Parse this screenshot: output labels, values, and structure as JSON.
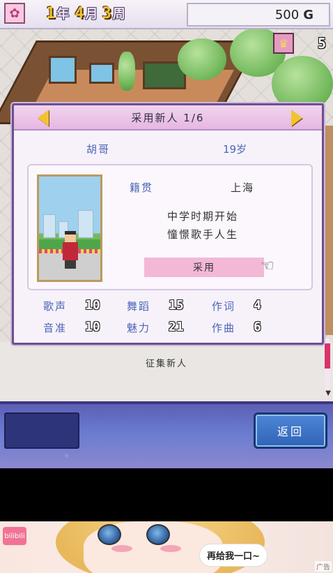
{
  "hud": {
    "year": "1",
    "year_unit": "年",
    "month": "4",
    "month_unit": "月",
    "week": "3",
    "week_unit": "周",
    "money": "500",
    "money_unit": "G",
    "trophy_count": "5"
  },
  "dialog": {
    "title": "采用新人 1/6",
    "candidate": {
      "name": "胡哥",
      "age": "19岁",
      "origin_label": "籍贯",
      "origin_value": "上海",
      "description_line1": "中学时期开始",
      "description_line2": "憧憬歌手人生"
    },
    "hire_button": "采用",
    "stats": [
      {
        "label": "歌声",
        "value": "10"
      },
      {
        "label": "舞蹈",
        "value": "15"
      },
      {
        "label": "作词",
        "value": "4"
      },
      {
        "label": "音准",
        "value": "10"
      },
      {
        "label": "魅力",
        "value": "21"
      },
      {
        "label": "作曲",
        "value": "6"
      }
    ]
  },
  "notice": "征集新人",
  "bottombar": {
    "return_button": "返回"
  },
  "ad": {
    "bubble_text": "再给我一口~",
    "tag": "广告",
    "logo_text": "bilibili"
  },
  "colors": {
    "accent_gold": "#f2c230",
    "label_blue": "#4a65b7",
    "dialog_border": "#6e4f8f",
    "hire_pink": "#f3b8d6",
    "return_blue": "#2f63b6"
  },
  "icons": [
    "flower-icon",
    "trophy-icon",
    "arrow-left-icon",
    "arrow-right-icon",
    "pointing-hand-icon",
    "scroll-down-icon"
  ]
}
